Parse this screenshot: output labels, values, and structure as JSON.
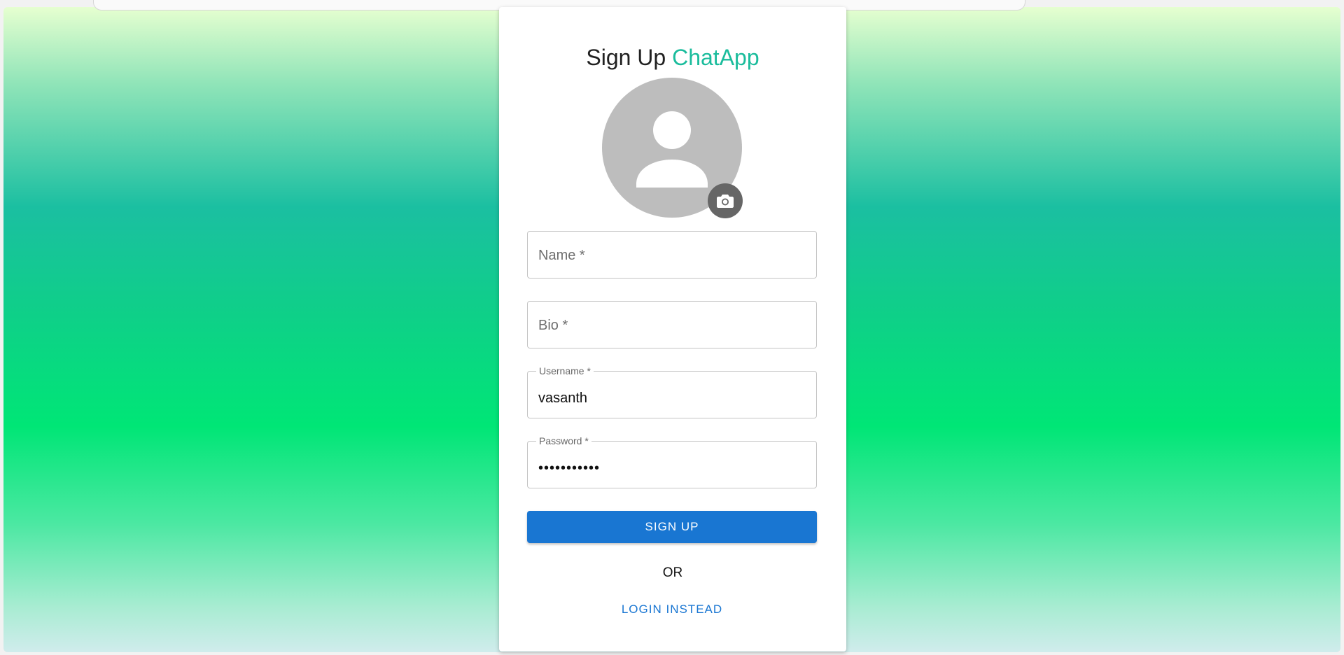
{
  "header": {
    "title_prefix": "Sign Up",
    "title_brand": "ChatApp"
  },
  "avatar": {
    "icon": "person-icon",
    "upload_icon": "camera-icon"
  },
  "form": {
    "name": {
      "placeholder": "Name *",
      "value": ""
    },
    "bio": {
      "placeholder": "Bio *",
      "value": ""
    },
    "username": {
      "label": "Username *",
      "value": "vasanth"
    },
    "password": {
      "label": "Password *",
      "value": "•••••••••••"
    }
  },
  "actions": {
    "signup_label": "SIGN UP",
    "or_label": "OR",
    "login_label": "LOGIN INSTEAD"
  },
  "colors": {
    "brand": "#1abc9c",
    "primary": "#1976d2",
    "avatar_bg": "#bdbdbd",
    "camera_bg": "#666666"
  }
}
